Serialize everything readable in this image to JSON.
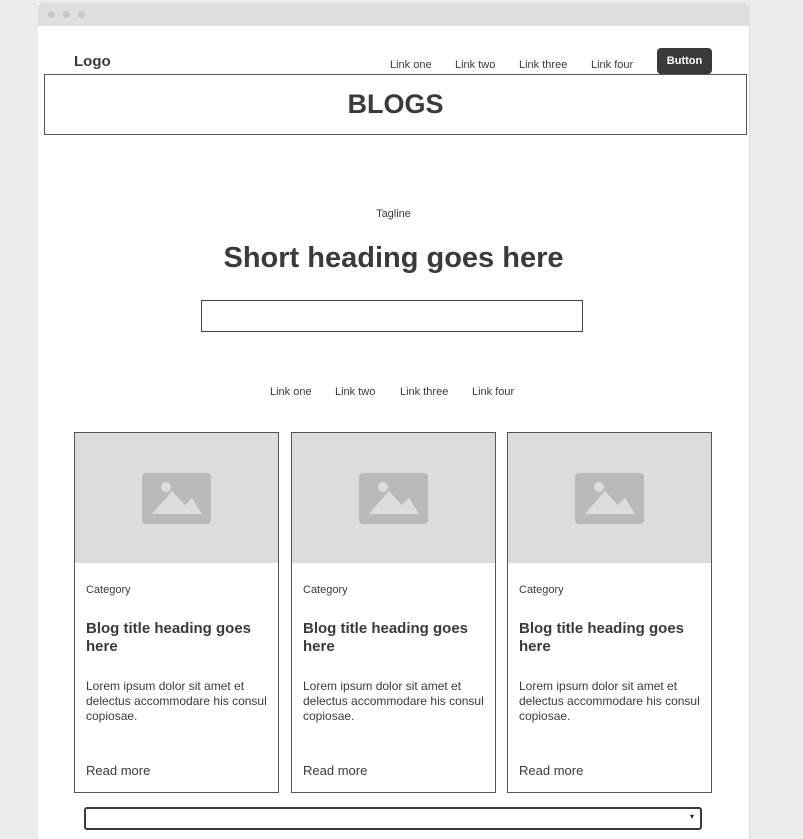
{
  "header": {
    "logo": "Logo",
    "nav_links": [
      "Link one",
      "Link two",
      "Link three",
      "Link four"
    ],
    "button_label": "Button"
  },
  "banner": {
    "title": "BLOGS"
  },
  "hero": {
    "tagline": "Tagline",
    "heading": "Short heading goes here",
    "search": {
      "value": "",
      "placeholder": ""
    }
  },
  "filters": [
    "Link one",
    "Link two",
    "Link three",
    "Link four"
  ],
  "cards": [
    {
      "image_icon": "image-placeholder-icon",
      "category": "Category",
      "title": "Blog title heading goes here",
      "body": "Lorem ipsum dolor sit amet et delectus accommodare his consul copiosae.",
      "link": "Read more"
    },
    {
      "image_icon": "image-placeholder-icon",
      "category": "Category",
      "title": "Blog title heading goes here",
      "body": "Lorem ipsum dolor sit amet et delectus accommodare his consul copiosae.",
      "link": "Read more"
    },
    {
      "image_icon": "image-placeholder-icon",
      "category": "Category",
      "title": "Blog title heading goes here",
      "body": "Lorem ipsum dolor sit amet et delectus accommodare his consul copiosae.",
      "link": "Read more"
    }
  ],
  "select": {
    "value": "",
    "arrow_icon": "dropdown-arrow-icon",
    "arrow_glyph": "▾"
  },
  "colors": {
    "dark": "#3a3a3a",
    "placeholder": "#dcdcdc",
    "page_bg": "#ebebeb"
  }
}
